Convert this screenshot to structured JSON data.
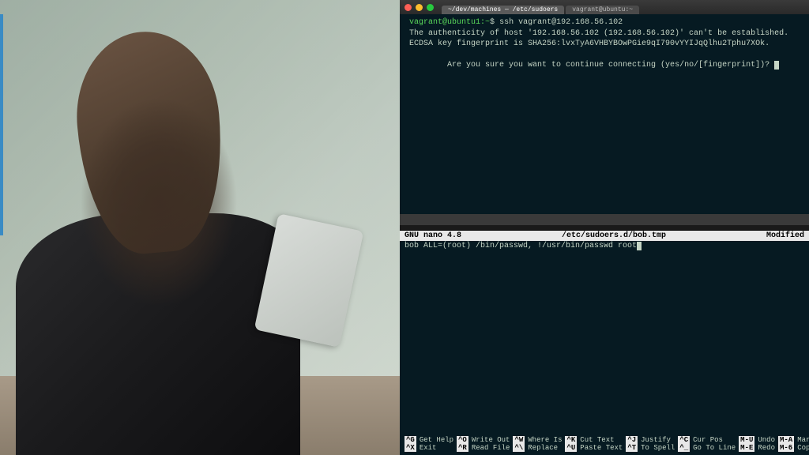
{
  "terminal_top": {
    "tabs": [
      {
        "label": "~/dev/machines — /etc/sudoers"
      },
      {
        "label": "vagrant@ubuntu:~"
      }
    ],
    "prompt": {
      "user_host": "vagrant@ubuntu1",
      "path": "~",
      "sep": ":",
      "symbol": "$"
    },
    "command": "ssh vagrant@192.168.56.102",
    "output": [
      "The authenticity of host '192.168.56.102 (192.168.56.102)' can't be established.",
      "ECDSA key fingerprint is SHA256:lvxTyA6VHBYBOwPGie9qI790vYYIJqQlhu2Tphu7XOk.",
      "Are you sure you want to continue connecting (yes/no/[fingerprint])? "
    ],
    "status_left": "",
    "status_right": ""
  },
  "nano": {
    "app": "GNU nano 4.8",
    "file": "/etc/sudoers.d/bob.tmp",
    "state": "Modified",
    "content": "bob ALL=(root) /bin/passwd, !/usr/bin/passwd root",
    "shortcuts_row1": [
      {
        "key": "^G",
        "label": "Get Help"
      },
      {
        "key": "^O",
        "label": "Write Out"
      },
      {
        "key": "^W",
        "label": "Where Is"
      },
      {
        "key": "^K",
        "label": "Cut Text"
      },
      {
        "key": "^J",
        "label": "Justify"
      },
      {
        "key": "^C",
        "label": "Cur Pos"
      },
      {
        "key": "M-U",
        "label": "Undo"
      },
      {
        "key": "M-A",
        "label": "Mark Text"
      }
    ],
    "shortcuts_row2": [
      {
        "key": "^X",
        "label": "Exit"
      },
      {
        "key": "^R",
        "label": "Read File"
      },
      {
        "key": "^\\",
        "label": "Replace"
      },
      {
        "key": "^U",
        "label": "Paste Text"
      },
      {
        "key": "^T",
        "label": "To Spell"
      },
      {
        "key": "^_",
        "label": "Go To Line"
      },
      {
        "key": "M-E",
        "label": "Redo"
      },
      {
        "key": "M-6",
        "label": "Copy Text"
      }
    ]
  }
}
